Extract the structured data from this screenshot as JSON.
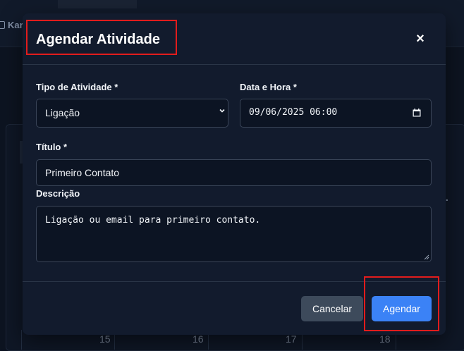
{
  "background": {
    "tab_label": "Kar",
    "weekday_fragment": "i.",
    "day_numbers": [
      "15",
      "16",
      "17",
      "18"
    ]
  },
  "modal": {
    "title": "Agendar Atividade",
    "close_symbol": "×",
    "activity_type": {
      "label": "Tipo de Atividade *",
      "value": "Ligação"
    },
    "datetime": {
      "label": "Data e Hora *",
      "value": "09/06/2025 06:00"
    },
    "title_field": {
      "label": "Título *",
      "value": "Primeiro Contato"
    },
    "description": {
      "label": "Descrição",
      "value": "Ligação ou email para primeiro contato."
    },
    "buttons": {
      "cancel": "Cancelar",
      "submit": "Agendar"
    }
  },
  "colors": {
    "primary": "#3b82f6",
    "highlight": "#e21c1c",
    "modal_bg": "#121b2d"
  }
}
